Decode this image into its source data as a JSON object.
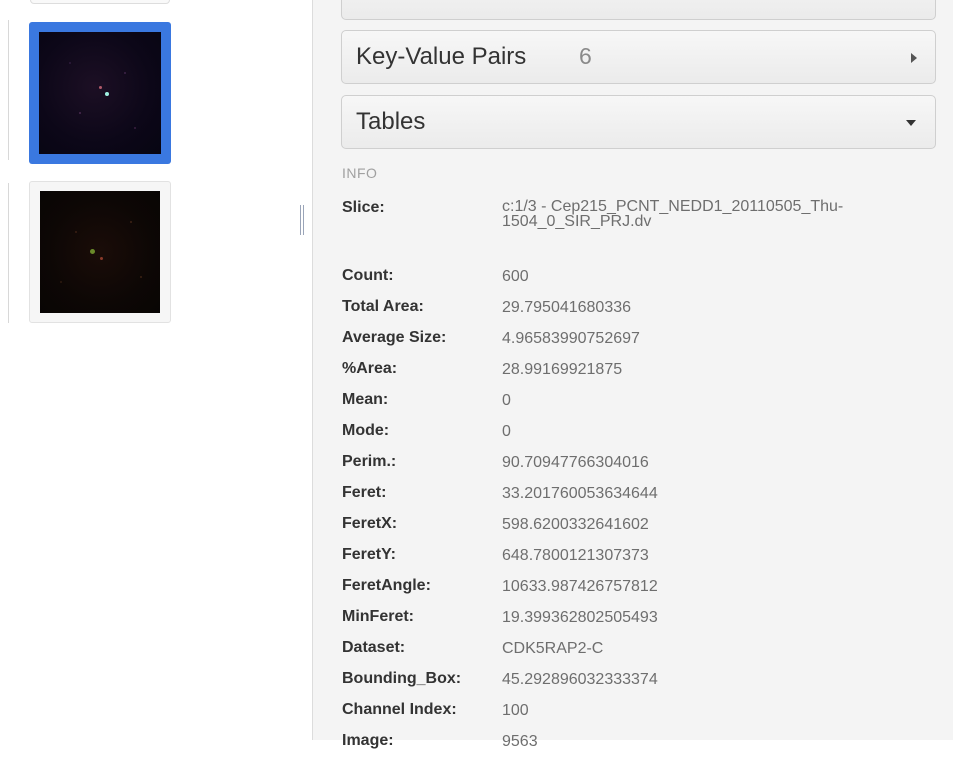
{
  "right_panel": {
    "key_value_pairs": {
      "label": "Key-Value Pairs",
      "count": "6"
    },
    "tables": {
      "label": "Tables"
    },
    "info": {
      "heading": "INFO",
      "rows": [
        {
          "key": "Slice:",
          "value": "c:1/3 - Cep215_PCNT_NEDD1_20110505_Thu-1504_0_SIR_PRJ.dv"
        },
        {
          "key": "Count:",
          "value": "600"
        },
        {
          "key": "Total Area:",
          "value": "29.795041680336"
        },
        {
          "key": "Average Size:",
          "value": "4.96583990752697"
        },
        {
          "key": "%Area:",
          "value": "28.99169921875"
        },
        {
          "key": "Mean:",
          "value": "0"
        },
        {
          "key": "Mode:",
          "value": "0"
        },
        {
          "key": "Perim.:",
          "value": "90.70947766304016"
        },
        {
          "key": "Feret:",
          "value": "33.201760053634644"
        },
        {
          "key": "FeretX:",
          "value": "598.6200332641602"
        },
        {
          "key": "FeretY:",
          "value": "648.7800121307373"
        },
        {
          "key": "FeretAngle:",
          "value": "10633.987426757812"
        },
        {
          "key": "MinFeret:",
          "value": "19.399362802505493"
        },
        {
          "key": "Dataset:",
          "value": "CDK5RAP2-C"
        },
        {
          "key": "Bounding_Box:",
          "value": "45.292896032333374"
        },
        {
          "key": "Channel Index:",
          "value": "100"
        },
        {
          "key": "Image:",
          "value": "9563"
        }
      ]
    }
  },
  "icons": {
    "kv_expand": "caret-right-icon",
    "tables_collapse": "caret-down-icon"
  },
  "colors": {
    "selection": "#3a78e0",
    "panel_background": "#f4f4f4"
  }
}
